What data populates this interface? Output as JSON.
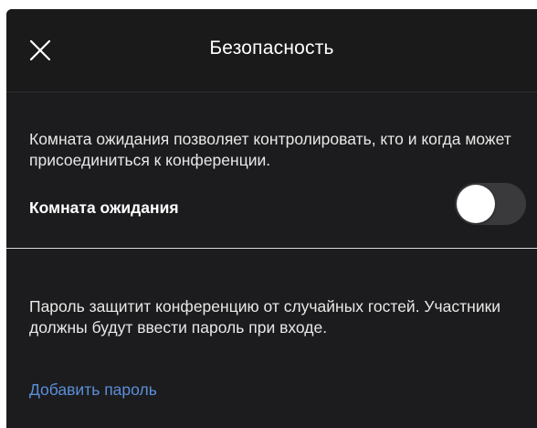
{
  "header": {
    "title": "Безопасность",
    "close_icon": "close-icon"
  },
  "waiting_room": {
    "description": "Комната ожидания позволяет контролировать, кто и когда может присоединиться к конференции.",
    "label": "Комната ожидания",
    "toggle_on": false
  },
  "password": {
    "description": "Пароль защитит конференцию от случайных гостей. Участники должны будут ввести пароль при входе.",
    "add_link": "Добавить пароль"
  },
  "colors": {
    "background": "#1c1c1e",
    "link": "#5b8fd9",
    "toggle_track": "#3a3a3c",
    "divider": "#d9d9d9"
  }
}
